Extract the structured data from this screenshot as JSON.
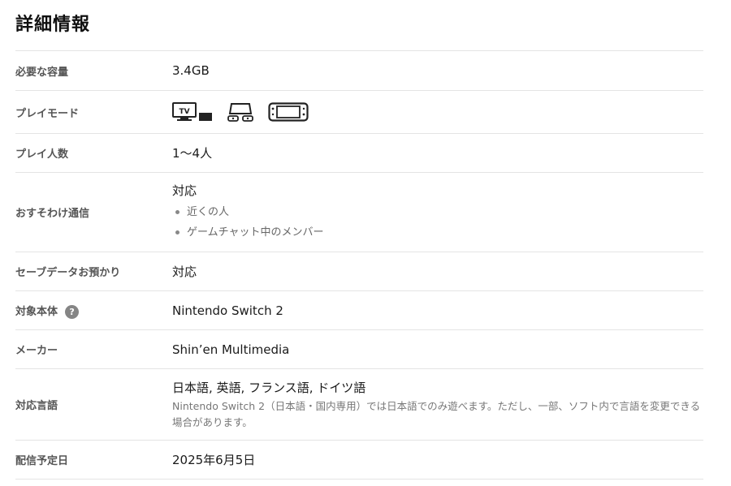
{
  "page": {
    "title": "詳細情報"
  },
  "rows": {
    "capacity": {
      "label": "必要な容量",
      "value": "3.4GB"
    },
    "play_mode": {
      "label": "プレイモード",
      "icons": [
        "tv-mode-icon",
        "tabletop-mode-icon",
        "handheld-mode-icon"
      ]
    },
    "players": {
      "label": "プレイ人数",
      "value": "1〜4人"
    },
    "share": {
      "label": "おすそわけ通信",
      "value": "対応",
      "items": [
        "近くの人",
        "ゲームチャット中のメンバー"
      ]
    },
    "save_cloud": {
      "label": "セーブデータお預かり",
      "value": "対応"
    },
    "console": {
      "label": "対象本体",
      "help": "?",
      "value": "Nintendo Switch 2"
    },
    "maker": {
      "label": "メーカー",
      "value": "Shin’en Multimedia"
    },
    "languages": {
      "label": "対応言語",
      "value": "日本語, 英語, フランス語, ドイツ語",
      "note": "Nintendo Switch 2（日本語・国内専用）では日本語でのみ遊べます。ただし、一部、ソフト内で言語を変更できる場合があります。"
    },
    "release": {
      "label": "配信予定日",
      "value": "2025年6月5日"
    }
  }
}
